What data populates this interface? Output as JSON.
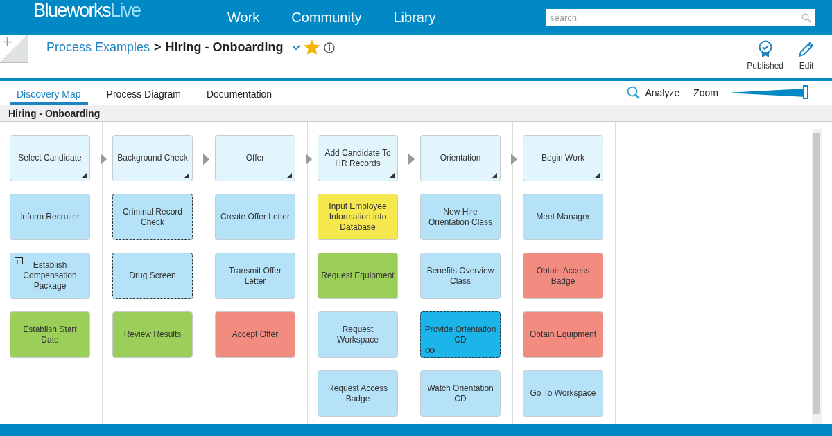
{
  "header": {
    "logo_main": "Blueworks",
    "logo_accent": "Live",
    "nav": [
      "Work",
      "Community",
      "Library"
    ],
    "search": {
      "placeholder": "search"
    }
  },
  "breadcrumb": {
    "parent": "Process Examples",
    "separator": ">",
    "current": "Hiring - Onboarding",
    "favorite": true
  },
  "actions": [
    {
      "kind": "published",
      "label": "Published"
    },
    {
      "kind": "edit",
      "label": "Edit"
    }
  ],
  "tabs": [
    {
      "label": "Discovery Map",
      "selected": true
    },
    {
      "label": "Process Diagram",
      "selected": false
    },
    {
      "label": "Documentation",
      "selected": false
    }
  ],
  "tools": {
    "analyze": "Analyze",
    "zoom": "Zoom",
    "zoom_level": {
      "level": 1
    }
  },
  "map_title": "Hiring - Onboarding",
  "columns": [
    {
      "milestone": "Select Candidate",
      "activities": [
        {
          "label": "Inform Recruiter",
          "color": "#b5e2f7",
          "dashed": false
        },
        {
          "label": "Establish Compensation Package",
          "color": "#b5e2f7",
          "dashed": false,
          "kind": "table"
        },
        {
          "label": "Establish Start Date",
          "color": "#9ccf5a",
          "dashed": false
        }
      ]
    },
    {
      "milestone": "Background Check",
      "activities": [
        {
          "label": "Criminal Record Check",
          "color": "#b5e2f7",
          "dashed": true
        },
        {
          "label": "Drug Screen",
          "color": "#b5e2f7",
          "dashed": true
        },
        {
          "label": "Review Results",
          "color": "#9ccf5a",
          "dashed": false
        }
      ]
    },
    {
      "milestone": "Offer",
      "activities": [
        {
          "label": "Create Offer Letter",
          "color": "#b5e2f7",
          "dashed": false
        },
        {
          "label": "Transmit Offer Letter",
          "color": "#b5e2f7",
          "dashed": false
        },
        {
          "label": "Accept Offer",
          "color": "#f28b80",
          "dashed": false
        }
      ]
    },
    {
      "milestone": "Add Candidate To HR Records",
      "activities": [
        {
          "label": "Input Employee Information into Database",
          "color": "#f5e94f",
          "dashed": false
        },
        {
          "label": "Request Equipment",
          "color": "#9ccf5a",
          "dashed": false
        },
        {
          "label": "Request Workspace",
          "color": "#b5e2f7",
          "dashed": false
        },
        {
          "label": "Request Access Badge",
          "color": "#b5e2f7",
          "dashed": false
        }
      ]
    },
    {
      "milestone": "Orientation",
      "activities": [
        {
          "label": "New Hire Orientation Class",
          "color": "#b5e2f7",
          "dashed": false
        },
        {
          "label": "Benefits Overview Class",
          "color": "#b5e2f7",
          "dashed": false
        },
        {
          "label": "Provide Orientation CD",
          "color": "#1cb5ea",
          "dashed": true,
          "kind": "linked"
        },
        {
          "label": "Watch Orientation CD",
          "color": "#b5e2f7",
          "dashed": false
        }
      ]
    },
    {
      "milestone": "Begin Work",
      "activities": [
        {
          "label": "Meet Manager",
          "color": "#b5e2f7",
          "dashed": false
        },
        {
          "label": "Obtain Access Badge",
          "color": "#f28b80",
          "dashed": false
        },
        {
          "label": "Obtain Equipment",
          "color": "#f28b80",
          "dashed": false
        },
        {
          "label": "Go To Workspace",
          "color": "#b5e2f7",
          "dashed": false
        }
      ]
    }
  ]
}
